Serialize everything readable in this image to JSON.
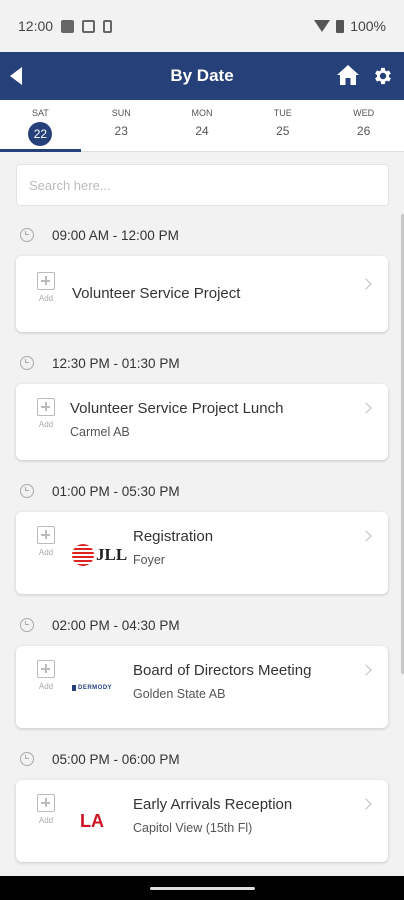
{
  "status_bar": {
    "time": "12:00",
    "battery": "100%",
    "icons": [
      "app-icon",
      "nfc-icon",
      "phone-icon",
      "wifi-icon",
      "battery-icon"
    ]
  },
  "app_bar": {
    "title": "By Date",
    "icons": [
      "back-icon",
      "home-icon",
      "gear-icon"
    ],
    "color": "#26407a"
  },
  "date_tabs": [
    {
      "dow": "SAT",
      "day": "22",
      "active": true
    },
    {
      "dow": "SUN",
      "day": "23",
      "active": false
    },
    {
      "dow": "MON",
      "day": "24",
      "active": false
    },
    {
      "dow": "TUE",
      "day": "25",
      "active": false
    },
    {
      "dow": "WED",
      "day": "26",
      "active": false
    }
  ],
  "search": {
    "placeholder": "Search here...",
    "value": ""
  },
  "sessions": [
    {
      "time_range": "09:00 AM - 12:00 PM",
      "event": {
        "add_label": "Add",
        "title": "Volunteer Service Project",
        "location": "",
        "logo": ""
      }
    },
    {
      "time_range": "12:30 PM - 01:30 PM",
      "event": {
        "add_label": "Add",
        "title": "Volunteer Service Project Lunch",
        "location": "Carmel AB",
        "logo": ""
      }
    },
    {
      "time_range": "01:00 PM - 05:30 PM",
      "event": {
        "add_label": "Add",
        "title": "Registration",
        "location": "Foyer",
        "logo": "JLL"
      }
    },
    {
      "time_range": "02:00 PM - 04:30 PM",
      "event": {
        "add_label": "Add",
        "title": "Board of Directors Meeting",
        "location": "Golden State AB",
        "logo": "DERMODY"
      }
    },
    {
      "time_range": "05:00 PM - 06:00 PM",
      "event": {
        "add_label": "Add",
        "title": "Early Arrivals Reception",
        "location": "Capitol View (15th Fl)",
        "logo": "LA"
      }
    }
  ]
}
